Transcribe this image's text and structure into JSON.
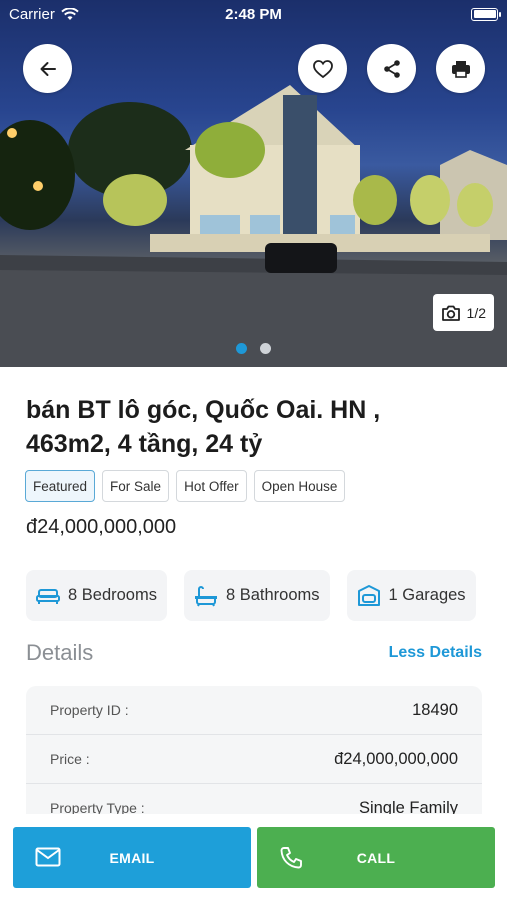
{
  "status_bar": {
    "carrier": "Carrier",
    "time": "2:48 PM"
  },
  "gallery": {
    "counter": "1/2",
    "page_count": 2,
    "active_index": 0
  },
  "top_actions": {
    "back_icon": "arrow-left-icon",
    "favorite_icon": "heart-icon",
    "share_icon": "share-icon",
    "print_icon": "printer-icon"
  },
  "listing": {
    "title": "bán BT lô góc, Quốc Oai. HN , 463m2, 4 tầng, 24 tỷ",
    "tags": [
      "Featured",
      "For Sale",
      "Hot Offer",
      "Open House"
    ],
    "price": "đ24,000,000,000"
  },
  "features": [
    {
      "icon": "bed-icon",
      "label": "8 Bedrooms"
    },
    {
      "icon": "bathtub-icon",
      "label": "8 Bathrooms"
    },
    {
      "icon": "garage-icon",
      "label": "1 Garages"
    }
  ],
  "details": {
    "heading": "Details",
    "toggle_label": "Less Details",
    "rows": [
      {
        "key": "Property ID :",
        "value": "18490"
      },
      {
        "key": "Price :",
        "value": "đ24,000,000,000"
      },
      {
        "key": "Property Type :",
        "value": "Single Family"
      }
    ]
  },
  "bottom_actions": {
    "email_label": "EMAIL",
    "call_label": "CALL"
  },
  "colors": {
    "accent": "#1e98d7",
    "email": "#1e9fd9",
    "call": "#4caf50"
  }
}
